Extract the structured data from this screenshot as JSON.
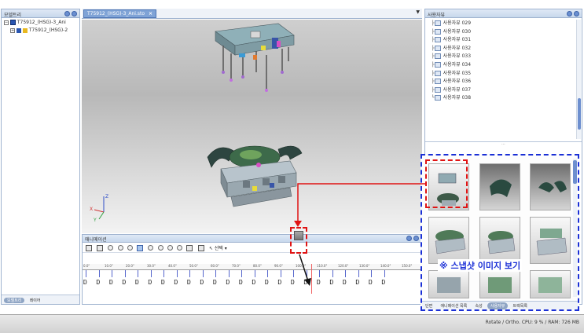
{
  "left_panel": {
    "title": "모델트리",
    "tree": [
      {
        "label": "T75912_(HSG)-3_Ani"
      },
      {
        "label": "T75912_(HSG)-2"
      }
    ],
    "bottom_tabs": [
      "모델트리",
      "레이어"
    ]
  },
  "document_tab": {
    "label": "T75912_(HSG)-3_Ani.sto"
  },
  "viewport": {
    "axis": {
      "x": "X",
      "y": "Y",
      "z": "Z"
    }
  },
  "animation_panel": {
    "title": "애니메이션",
    "toolbar_select_label": "선택",
    "ruler_labels": [
      "0.0\"",
      "10.0\"",
      "20.0\"",
      "30.0\"",
      "40.0\"",
      "50.0\"",
      "60.0\"",
      "70.0\"",
      "80.0\"",
      "90.0\"",
      "100.0\"",
      "110.0\"",
      "120.0\"",
      "130.0\"",
      "140.0\"",
      "150.0\""
    ]
  },
  "right_panel": {
    "title": "사용자뷰",
    "items": [
      {
        "label": "사용자뷰 029"
      },
      {
        "label": "사용자뷰 030"
      },
      {
        "label": "사용자뷰 031"
      },
      {
        "label": "사용자뷰 032"
      },
      {
        "label": "사용자뷰 033"
      },
      {
        "label": "사용자뷰 034"
      },
      {
        "label": "사용자뷰 035"
      },
      {
        "label": "사용자뷰 036"
      },
      {
        "label": "사용자뷰 037"
      },
      {
        "label": "사용자뷰 038"
      }
    ],
    "annotation": "※ 스냅샷 이미지 보기",
    "bottom_tabs": [
      "단면",
      "애니메이션 목록",
      "속성",
      "사용자뷰",
      "트랙목록"
    ],
    "active_tab_index": 3
  },
  "status_bar": {
    "text": "Rotate / Ortho.  CPU: 9 % / RAM: 726 MB"
  },
  "colors": {
    "annotation_blue": "#1a2fd6",
    "annotation_red": "#e01414",
    "timeline_cursor": "#f06060"
  }
}
